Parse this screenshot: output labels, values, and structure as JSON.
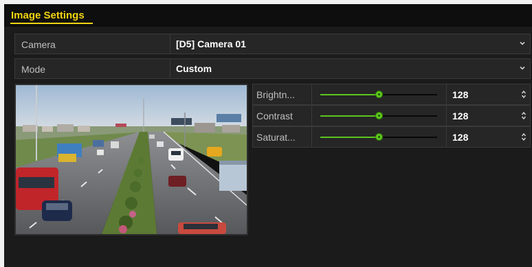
{
  "page": {
    "title": "Image Settings"
  },
  "camera": {
    "label": "Camera",
    "value": "[D5] Camera 01"
  },
  "mode": {
    "label": "Mode",
    "value": "Custom"
  },
  "preview": {
    "icon": "camera-preview-image"
  },
  "adjustments": [
    {
      "label": "Brightn...",
      "value": "128",
      "level": 0.5
    },
    {
      "label": "Contrast",
      "value": "128",
      "level": 0.5
    },
    {
      "label": "Saturat...",
      "value": "128",
      "level": 0.5
    }
  ],
  "colors": {
    "accent": "#f2d411",
    "slider": "#5ec51e",
    "background": "#1b1b1b",
    "field": "#262626"
  },
  "icons": {
    "dropdown": "chevron-down-icon",
    "spinner": "up-down-spinner-icon"
  }
}
